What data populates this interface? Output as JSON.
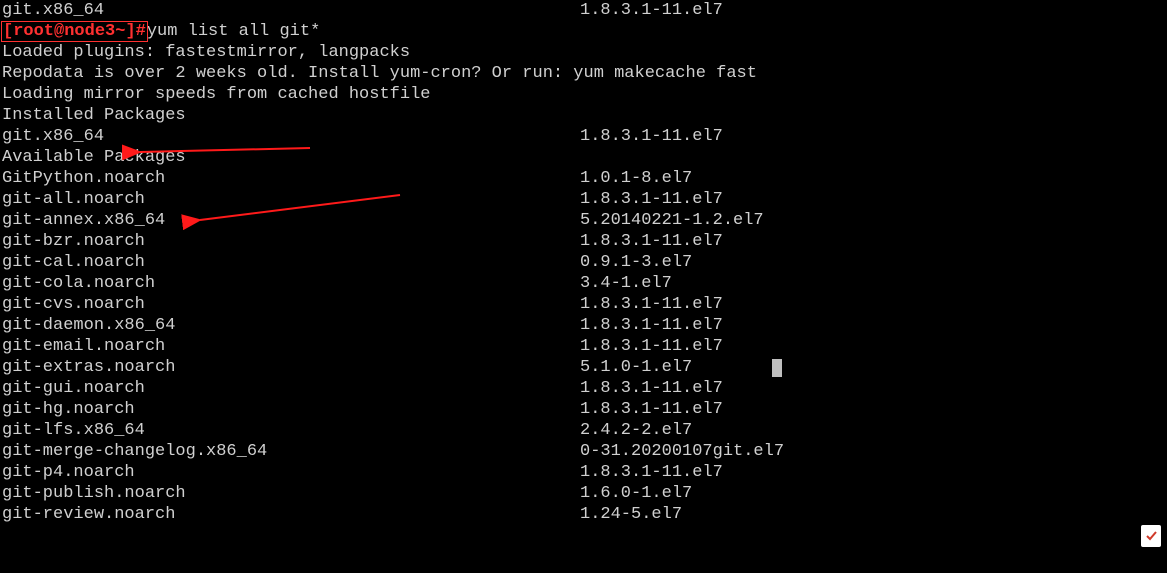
{
  "top_line": {
    "pkg": "git.x86_64",
    "ver": "1.8.3.1-11.el7"
  },
  "prompt": {
    "open": "[",
    "user": "root",
    "at": "@",
    "host": "node3",
    "tilde": "~",
    "close": "]",
    "hash": "#",
    "command": "yum list all git*"
  },
  "msgs": [
    "Loaded plugins: fastestmirror, langpacks",
    "Repodata is over 2 weeks old. Install yum-cron? Or run: yum makecache fast",
    "Loading mirror speeds from cached hostfile"
  ],
  "installed_header": "Installed Packages",
  "installed": [
    {
      "pkg": "git.x86_64",
      "ver": "1.8.3.1-11.el7"
    }
  ],
  "available_header": "Available Packages",
  "available": [
    {
      "pkg": "GitPython.noarch",
      "ver": "1.0.1-8.el7"
    },
    {
      "pkg": "git-all.noarch",
      "ver": "1.8.3.1-11.el7"
    },
    {
      "pkg": "git-annex.x86_64",
      "ver": "5.20140221-1.2.el7"
    },
    {
      "pkg": "git-bzr.noarch",
      "ver": "1.8.3.1-11.el7"
    },
    {
      "pkg": "git-cal.noarch",
      "ver": "0.9.1-3.el7"
    },
    {
      "pkg": "git-cola.noarch",
      "ver": "3.4-1.el7"
    },
    {
      "pkg": "git-cvs.noarch",
      "ver": "1.8.3.1-11.el7"
    },
    {
      "pkg": "git-daemon.x86_64",
      "ver": "1.8.3.1-11.el7"
    },
    {
      "pkg": "git-email.noarch",
      "ver": "1.8.3.1-11.el7"
    },
    {
      "pkg": "git-extras.noarch",
      "ver": "5.1.0-1.el7",
      "cursor": true
    },
    {
      "pkg": "git-gui.noarch",
      "ver": "1.8.3.1-11.el7"
    },
    {
      "pkg": "git-hg.noarch",
      "ver": "1.8.3.1-11.el7"
    },
    {
      "pkg": "git-lfs.x86_64",
      "ver": "2.4.2-2.el7"
    },
    {
      "pkg": "git-merge-changelog.x86_64",
      "ver": "0-31.20200107git.el7"
    },
    {
      "pkg": "git-p4.noarch",
      "ver": "1.8.3.1-11.el7"
    },
    {
      "pkg": "git-publish.noarch",
      "ver": "1.6.0-1.el7"
    },
    {
      "pkg": "git-review.noarch",
      "ver": "1.24-5.el7"
    }
  ],
  "annotation_color": "#ff1a1a",
  "icon_name": "note-check-icon"
}
